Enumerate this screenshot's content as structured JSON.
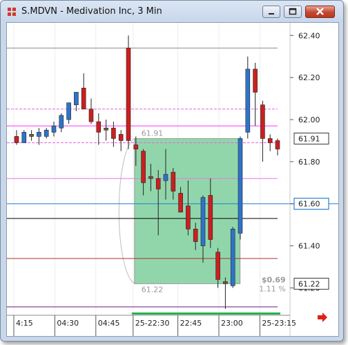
{
  "window": {
    "title": "S.MDVN - Medivation Inc, 3 Min"
  },
  "chart_data": {
    "type": "candlestick",
    "symbol": "S.MDVN",
    "interval": "3 Min",
    "ylim": [
      61.07,
      62.46
    ],
    "y_ticks": [
      "62.40",
      "62.20",
      "62.00",
      "61.80",
      "61.60",
      "61.40",
      "61.20"
    ],
    "x_ticks": [
      "4:15",
      "04:30",
      "04:45",
      "25-22:30",
      "22:45",
      "23:00",
      "25-23:15"
    ],
    "x_tick_bars": [
      0,
      5.5,
      11,
      16,
      22,
      27.5,
      33
    ],
    "price_labels": [
      {
        "text": "61.91",
        "value": 61.91,
        "style": "box"
      },
      {
        "text": "61.60",
        "value": 61.6,
        "style": "blue"
      },
      {
        "text": "61.22",
        "value": 61.22,
        "style": "box"
      }
    ],
    "candles": [
      {
        "o": 61.92,
        "h": 61.95,
        "l": 61.88,
        "c": 61.89
      },
      {
        "o": 61.89,
        "h": 61.95,
        "l": 61.89,
        "c": 61.94
      },
      {
        "o": 61.93,
        "h": 61.95,
        "l": 61.9,
        "c": 61.92
      },
      {
        "o": 61.92,
        "h": 61.96,
        "l": 61.88,
        "c": 61.94
      },
      {
        "o": 61.92,
        "h": 61.96,
        "l": 61.91,
        "c": 61.95
      },
      {
        "o": 61.94,
        "h": 61.99,
        "l": 61.92,
        "c": 61.97
      },
      {
        "o": 61.96,
        "h": 62.03,
        "l": 61.94,
        "c": 62.02
      },
      {
        "o": 62.0,
        "h": 62.08,
        "l": 61.98,
        "c": 62.08
      },
      {
        "o": 62.07,
        "h": 62.13,
        "l": 62.04,
        "c": 62.13
      },
      {
        "o": 62.15,
        "h": 62.22,
        "l": 62.07,
        "c": 62.05
      },
      {
        "o": 62.05,
        "h": 62.1,
        "l": 61.98,
        "c": 61.99
      },
      {
        "o": 61.99,
        "h": 62.03,
        "l": 61.88,
        "c": 61.94
      },
      {
        "o": 61.96,
        "h": 62.0,
        "l": 61.9,
        "c": 61.95
      },
      {
        "o": 61.96,
        "h": 61.99,
        "l": 61.87,
        "c": 61.91
      },
      {
        "o": 61.93,
        "h": 61.95,
        "l": 61.85,
        "c": 61.9
      },
      {
        "o": 62.34,
        "h": 62.4,
        "l": 61.86,
        "c": 61.9
      },
      {
        "o": 61.88,
        "h": 61.92,
        "l": 61.78,
        "c": 61.86
      },
      {
        "o": 61.85,
        "h": 61.86,
        "l": 61.64,
        "c": 61.7
      },
      {
        "o": 61.72,
        "h": 61.79,
        "l": 61.66,
        "c": 61.73
      },
      {
        "o": 61.72,
        "h": 61.76,
        "l": 61.45,
        "c": 61.67
      },
      {
        "o": 61.71,
        "h": 61.86,
        "l": 61.62,
        "c": 61.74
      },
      {
        "o": 61.75,
        "h": 61.77,
        "l": 61.62,
        "c": 61.66
      },
      {
        "o": 61.65,
        "h": 61.68,
        "l": 61.56,
        "c": 61.56
      },
      {
        "o": 61.59,
        "h": 61.71,
        "l": 61.45,
        "c": 61.48
      },
      {
        "o": 61.48,
        "h": 61.51,
        "l": 61.38,
        "c": 61.42
      },
      {
        "o": 61.4,
        "h": 61.64,
        "l": 61.32,
        "c": 61.63
      },
      {
        "o": 61.64,
        "h": 61.72,
        "l": 61.39,
        "c": 61.43
      },
      {
        "o": 61.37,
        "h": 61.39,
        "l": 61.2,
        "c": 61.24
      },
      {
        "o": 61.23,
        "h": 61.25,
        "l": 61.1,
        "c": 61.22
      },
      {
        "o": 61.21,
        "h": 61.49,
        "l": 61.2,
        "c": 61.48
      },
      {
        "o": 61.46,
        "h": 61.92,
        "l": 61.43,
        "c": 61.91
      },
      {
        "o": 61.94,
        "h": 62.3,
        "l": 61.91,
        "c": 62.24
      },
      {
        "o": 62.24,
        "h": 62.27,
        "l": 61.97,
        "c": 62.13
      },
      {
        "o": 62.07,
        "h": 62.09,
        "l": 61.8,
        "c": 61.91
      },
      {
        "o": 61.91,
        "h": 61.93,
        "l": 61.85,
        "c": 61.89
      },
      {
        "o": 61.9,
        "h": 61.91,
        "l": 61.83,
        "c": 61.86
      }
    ],
    "hlines": [
      {
        "value": 62.34,
        "color": "#8e8e8e",
        "dash": false
      },
      {
        "value": 62.05,
        "color": "#e066e0",
        "dash": true
      },
      {
        "value": 61.97,
        "color": "#ff33ff",
        "dash": false
      },
      {
        "value": 61.89,
        "color": "#e066e0",
        "dash": true
      },
      {
        "value": 61.72,
        "color": "#e879e8",
        "dash": false
      },
      {
        "value": 61.6,
        "color": "#1f7fd4",
        "dash": false
      },
      {
        "value": 61.53,
        "color": "#000000",
        "dash": false
      },
      {
        "value": 61.34,
        "color": "#b3302a",
        "dash": false
      },
      {
        "value": 61.11,
        "color": "#6e1480",
        "dash": false
      }
    ],
    "measure_box": {
      "from_bar": 16,
      "to_bar": 29.6,
      "top": 61.91,
      "bottom": 61.22,
      "top_label": "61.91",
      "bottom_label": "61.22",
      "change": "$0.69",
      "change_pct": "1.11 %",
      "fill": "#7ecf9c"
    },
    "colors": {
      "up": "#2e74c8",
      "down": "#cc1f1f",
      "doji": "#7a5a2a"
    }
  }
}
